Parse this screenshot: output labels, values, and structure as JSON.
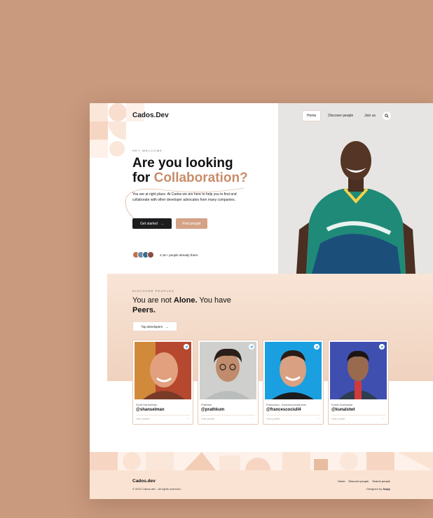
{
  "brand": "Cados.Dev",
  "nav": {
    "items": [
      "Home",
      "Discover people",
      "Join us"
    ],
    "active": "Home"
  },
  "hero": {
    "eyebrow": "HEY WELCOME",
    "title_line1": "Are you looking",
    "title_line2_plain": "for ",
    "title_line2_accent": "Collaboration?",
    "text": "You are at right place. At Cados we are here to help you to find and collaborate with other developer advocates from many companies.",
    "primary_button": "Get started",
    "secondary_button": "Find people",
    "people_count": "2.1K+ people already there."
  },
  "discover": {
    "eyebrow": "DISCOVER PEOPLES",
    "title_plain1": "You are not ",
    "title_bold1": "Alone.",
    "title_plain2": " You have ",
    "title_bold2": "Peers.",
    "button": "Top developers"
  },
  "cards": [
    {
      "name": "Scott Hanselman",
      "handle": "@shanselman",
      "link": "Visit profile"
    },
    {
      "name": "Pratham",
      "handle": "@prathkum",
      "link": "Visit profile"
    },
    {
      "name": "Francesco - francescociulla.lens",
      "handle": "@francescociull4",
      "link": "Visit profile"
    },
    {
      "name": "Kunal Kushwaha",
      "handle": "@kunalstwt",
      "link": "Visit profile"
    }
  ],
  "footer": {
    "logo": "Cados.dev",
    "copyright": "© 2022 Cados.dev - All rights reserved.",
    "links": [
      "Home",
      "Discover people",
      "Search people"
    ],
    "designed_prefix": "Designed by ",
    "designer": "Sujay"
  },
  "colors": {
    "background": "#c99a7e",
    "accent": "#c98c6a",
    "button_dark": "#1d1d1f",
    "button_tan": "#d4a286",
    "twitter": "#1d9bf0"
  }
}
